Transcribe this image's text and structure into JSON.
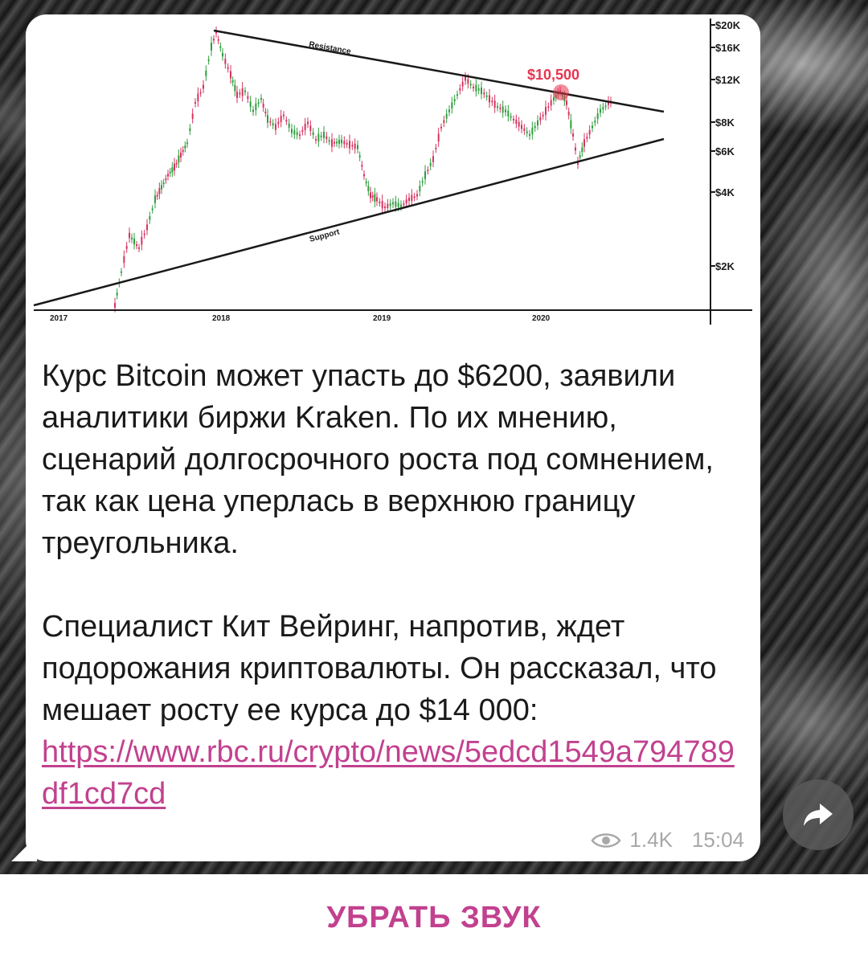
{
  "chart": {
    "price_labels": [
      "$20K",
      "$16K",
      "$12K",
      "$8K",
      "$6K",
      "$4K",
      "$2K"
    ],
    "year_labels": [
      "2017",
      "2018",
      "2019",
      "2020"
    ],
    "resistance_label": "Resistance",
    "support_label": "Support",
    "highlight_price": "$10,500",
    "colors": {
      "up": "#2e9e3e",
      "down": "#d6335f",
      "highlight": "#e8334f",
      "trend": "#1a1a1a"
    }
  },
  "message": {
    "paragraph1": "Курс Bitcoin может упасть до $6200, заявили аналитики биржи Kraken. По их мнению, сценарий долгосрочного роста под сомнением, так как цена уперлась в верхнюю границу треугольника.",
    "paragraph2": "Специалист Кит Вейринг, напротив, ждет подорожания криптовалюты. Он рассказал, что мешает росту ее курса до $14 000:",
    "link": "https://www.rbc.ru/crypto/news/5edcd1549a794789df1cd7cd",
    "views": "1.4K",
    "time": "15:04"
  },
  "bottom": {
    "mute_label": "УБРАТЬ ЗВУК"
  },
  "icons": {
    "share": "share-arrow-icon",
    "views": "eye-icon"
  },
  "colors": {
    "accent": "#c2418f",
    "meta": "#a8a8a8",
    "bubble": "#ffffff"
  }
}
